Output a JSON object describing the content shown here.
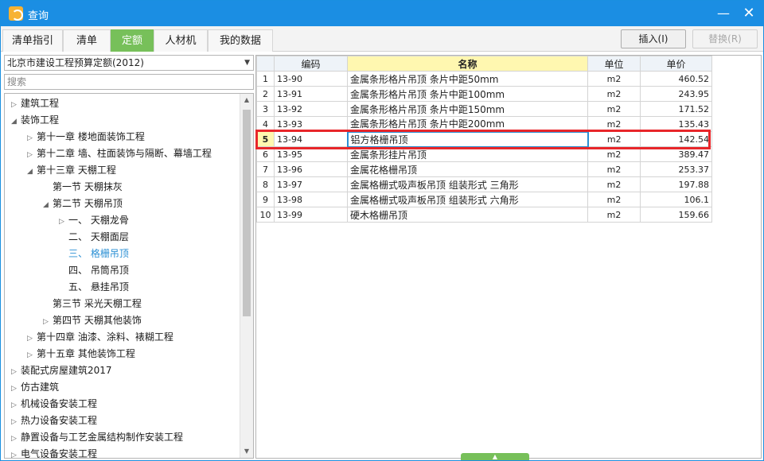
{
  "window": {
    "title": "查询",
    "icon": "app-logo-icon",
    "min": "minimize-icon",
    "close": "close-icon"
  },
  "tabs": [
    {
      "label": "清单指引",
      "active": false
    },
    {
      "label": "清单",
      "active": false
    },
    {
      "label": "定额",
      "active": true
    },
    {
      "label": "人材机",
      "active": false
    },
    {
      "label": "我的数据",
      "active": false
    }
  ],
  "actions": {
    "insert": "插入(I)",
    "replace": "替换(R)"
  },
  "quota_library": {
    "selected": "北京市建设工程预算定额(2012)"
  },
  "search": {
    "placeholder": "搜索"
  },
  "tree": [
    {
      "label": "建筑工程",
      "level": 0,
      "toggle": "▷"
    },
    {
      "label": "装饰工程",
      "level": 0,
      "toggle": "◢"
    },
    {
      "label": "第十一章  楼地面装饰工程",
      "level": 1,
      "toggle": "▷"
    },
    {
      "label": "第十二章  墙、柱面装饰与隔断、幕墙工程",
      "level": 1,
      "toggle": "▷"
    },
    {
      "label": "第十三章  天棚工程",
      "level": 1,
      "toggle": "◢"
    },
    {
      "label": "第一节  天棚抹灰",
      "level": 2,
      "toggle": ""
    },
    {
      "label": "第二节  天棚吊顶",
      "level": 2,
      "toggle": "◢"
    },
    {
      "label": "一、  天棚龙骨",
      "level": 3,
      "toggle": "▷"
    },
    {
      "label": "二、  天棚面层",
      "level": 3,
      "toggle": ""
    },
    {
      "label": "三、  格栅吊顶",
      "level": 3,
      "toggle": "",
      "selected": true
    },
    {
      "label": "四、  吊筒吊顶",
      "level": 3,
      "toggle": ""
    },
    {
      "label": "五、  悬挂吊顶",
      "level": 3,
      "toggle": ""
    },
    {
      "label": "第三节  采光天棚工程",
      "level": 2,
      "toggle": ""
    },
    {
      "label": "第四节  天棚其他装饰",
      "level": 2,
      "toggle": "▷"
    },
    {
      "label": "第十四章  油漆、涂料、裱糊工程",
      "level": 1,
      "toggle": "▷"
    },
    {
      "label": "第十五章  其他装饰工程",
      "level": 1,
      "toggle": "▷"
    },
    {
      "label": "装配式房屋建筑2017",
      "level": 0,
      "toggle": "▷"
    },
    {
      "label": "仿古建筑",
      "level": 0,
      "toggle": "▷"
    },
    {
      "label": "机械设备安装工程",
      "level": 0,
      "toggle": "▷"
    },
    {
      "label": "热力设备安装工程",
      "level": 0,
      "toggle": "▷"
    },
    {
      "label": "静置设备与工艺金属结构制作安装工程",
      "level": 0,
      "toggle": "▷"
    },
    {
      "label": "电气设备安装工程",
      "level": 0,
      "toggle": "▷"
    }
  ],
  "grid": {
    "columns": [
      "",
      "编码",
      "名称",
      "单位",
      "单价"
    ],
    "rows": [
      {
        "idx": "1",
        "code": "13-90",
        "name": "金属条形格片吊顶 条片中距50mm",
        "unit": "m2",
        "price": "460.52"
      },
      {
        "idx": "2",
        "code": "13-91",
        "name": "金属条形格片吊顶 条片中距100mm",
        "unit": "m2",
        "price": "243.95"
      },
      {
        "idx": "3",
        "code": "13-92",
        "name": "金属条形格片吊顶 条片中距150mm",
        "unit": "m2",
        "price": "171.52"
      },
      {
        "idx": "4",
        "code": "13-93",
        "name": "金属条形格片吊顶 条片中距200mm",
        "unit": "m2",
        "price": "135.43"
      },
      {
        "idx": "5",
        "code": "13-94",
        "name": "铝方格栅吊顶",
        "unit": "m2",
        "price": "142.54",
        "current": true
      },
      {
        "idx": "6",
        "code": "13-95",
        "name": "金属条形挂片吊顶",
        "unit": "m2",
        "price": "389.47"
      },
      {
        "idx": "7",
        "code": "13-96",
        "name": "金属花格栅吊顶",
        "unit": "m2",
        "price": "253.37"
      },
      {
        "idx": "8",
        "code": "13-97",
        "name": "金属格栅式吸声板吊顶 组装形式 三角形",
        "unit": "m2",
        "price": "197.88"
      },
      {
        "idx": "9",
        "code": "13-98",
        "name": "金属格栅式吸声板吊顶 组装形式 六角形",
        "unit": "m2",
        "price": "106.1"
      },
      {
        "idx": "10",
        "code": "13-99",
        "name": "硬木格栅吊顶",
        "unit": "m2",
        "price": "159.66"
      }
    ]
  },
  "colors": {
    "titlebar": "#1b8ee3",
    "active_tab": "#77c05a",
    "highlight": "#e8262a",
    "name_header": "#fff7b0",
    "selected_tree": "#2a8fd4"
  }
}
